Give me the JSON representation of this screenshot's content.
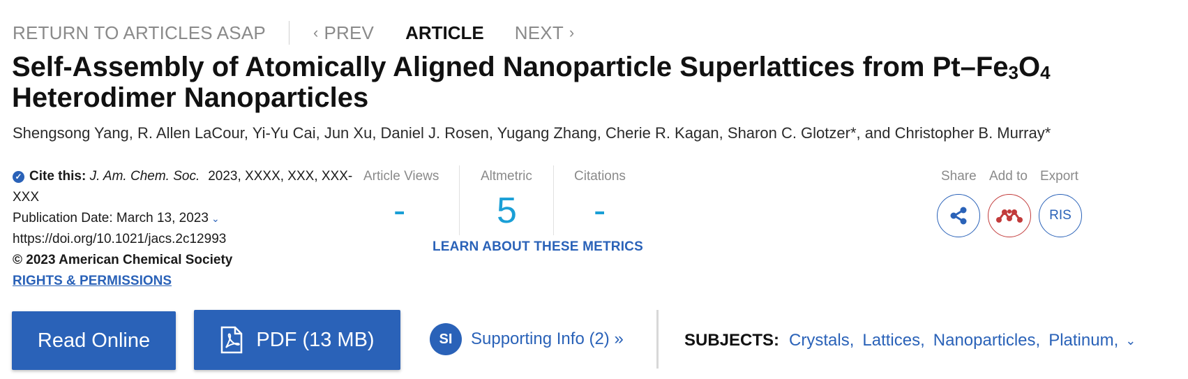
{
  "nav": {
    "return_label": "RETURN TO ARTICLES ASAP",
    "prev_label": "PREV",
    "article_label": "ARTICLE",
    "next_label": "NEXT"
  },
  "title": {
    "part1": "Self-Assembly of Atomically Aligned Nanoparticle Superlattices from Pt–Fe",
    "sub1": "3",
    "part2": "O",
    "sub2": "4",
    "part3": " Heterodimer Nanoparticles"
  },
  "authors": "Shengsong Yang, R. Allen LaCour, Yi-Yu Cai, Jun Xu, Daniel J. Rosen, Yugang Zhang, Cherie R. Kagan, Sharon C. Glotzer*, and Christopher B. Murray*",
  "citation": {
    "cite_label": "Cite this:",
    "journal": "J. Am. Chem. Soc.",
    "ref": "2023, XXXX, XXX, XXX-XXX",
    "pub_date": "Publication Date: March 13, 2023",
    "doi": "https://doi.org/10.1021/jacs.2c12993",
    "copyright": "© 2023 American Chemical Society",
    "rights": "RIGHTS & PERMISSIONS"
  },
  "metrics": {
    "views_label": "Article Views",
    "views_value": "-",
    "altmetric_label": "Altmetric",
    "altmetric_value": "5",
    "citations_label": "Citations",
    "citations_value": "-",
    "learn_label": "LEARN ABOUT THESE METRICS"
  },
  "actions": {
    "share_label": "Share",
    "add_label": "Add to",
    "export_label": "Export",
    "ris_label": "RIS"
  },
  "buttons": {
    "read_online": "Read Online",
    "pdf": "PDF (13 MB)"
  },
  "supporting": {
    "badge": "SI",
    "label": "Supporting Info (2) »"
  },
  "subjects": {
    "label": "SUBJECTS:",
    "items": [
      "Crystals",
      "Lattices",
      "Nanoparticles",
      "Platinum"
    ]
  },
  "colors": {
    "accent": "#2a62b8",
    "metric": "#1a9fd6",
    "mendeley": "#c23b3b"
  }
}
